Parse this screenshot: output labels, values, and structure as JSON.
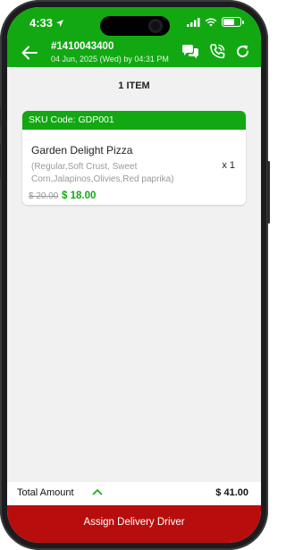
{
  "status_bar": {
    "time": "4:33",
    "icons": [
      "location-arrow-icon",
      "signal-icon",
      "wifi-icon",
      "battery-icon"
    ]
  },
  "app_bar": {
    "order_number": "#1410043400",
    "order_date": "04 Jun, 2025 (Wed) by 04:31 PM",
    "icons": [
      "back-arrow-icon",
      "chat-icon",
      "phone-call-icon",
      "refresh-icon"
    ]
  },
  "items_count": "1 ITEM",
  "items": [
    {
      "sku": "SKU Code: GDP001",
      "name": "Garden Delight Pizza",
      "options": "(Regular,Soft Crust, Sweet Corn,Jalapinos,Olivies,Red paprika)",
      "quantity": "x 1",
      "original_price": "$ 20.00",
      "price": "$ 18.00"
    }
  ],
  "footer": {
    "total_label": "Total Amount",
    "total_value": "$ 41.00",
    "assign_label": "Assign Delivery Driver"
  },
  "colors": {
    "brand_green": "#12a812",
    "action_red": "#b80d0d",
    "background": "#f1f1f1"
  }
}
